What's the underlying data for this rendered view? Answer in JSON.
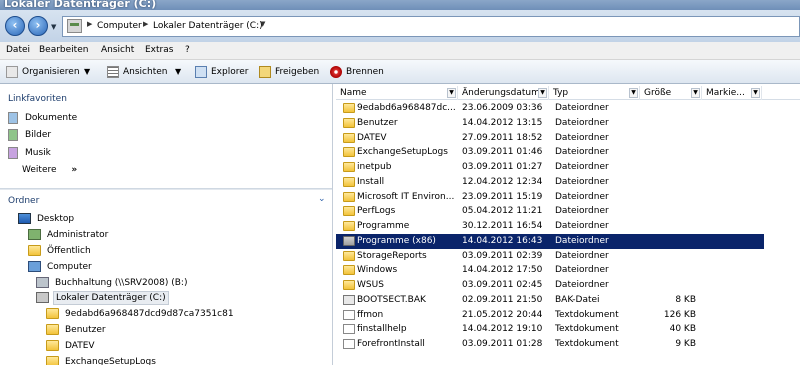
{
  "window": {
    "title": "Lokaler Datenträger (C:)"
  },
  "address": {
    "crumbs": [
      "Computer",
      "Lokaler Datenträger (C:)"
    ]
  },
  "menu": [
    "Datei",
    "Bearbeiten",
    "Ansicht",
    "Extras",
    "?"
  ],
  "toolbar": {
    "organize": "Organisieren",
    "views": "Ansichten",
    "explorer": "Explorer",
    "share": "Freigeben",
    "burn": "Brennen"
  },
  "left": {
    "favorites_title": "Linkfavoriten",
    "favorites": [
      "Dokumente",
      "Bilder",
      "Musik",
      "Weitere"
    ],
    "more_chevron": "»",
    "folders_title": "Ordner",
    "tree": [
      {
        "label": "Desktop",
        "icon": "desktop-icon"
      },
      {
        "label": "Administrator",
        "icon": "user-icon"
      },
      {
        "label": "Öffentlich",
        "icon": "folder-icon"
      },
      {
        "label": "Computer",
        "icon": "computer-icon"
      },
      {
        "label": "Buchhaltung (\\\\SRV2008) (B:)",
        "icon": "network-drive-icon"
      },
      {
        "label": "Lokaler Datenträger (C:)",
        "icon": "hard-drive-icon"
      },
      {
        "label": "9edabd6a968487dcd9d87ca7351c81",
        "icon": "folder-icon"
      },
      {
        "label": "Benutzer",
        "icon": "folder-icon"
      },
      {
        "label": "DATEV",
        "icon": "folder-icon"
      },
      {
        "label": "ExchangeSetupLogs",
        "icon": "folder-icon"
      }
    ]
  },
  "columns": [
    "Name",
    "Änderungsdatum",
    "Typ",
    "Größe",
    "Markie..."
  ],
  "files": [
    {
      "name": "9edabd6a968487dc...",
      "date": "23.06.2009 03:36",
      "type": "Dateiordner",
      "size": "",
      "icon": "folder-icon"
    },
    {
      "name": "Benutzer",
      "date": "14.04.2012 13:15",
      "type": "Dateiordner",
      "size": "",
      "icon": "folder-icon"
    },
    {
      "name": "DATEV",
      "date": "27.09.2011 18:52",
      "type": "Dateiordner",
      "size": "",
      "icon": "folder-icon"
    },
    {
      "name": "ExchangeSetupLogs",
      "date": "03.09.2011 01:46",
      "type": "Dateiordner",
      "size": "",
      "icon": "folder-icon"
    },
    {
      "name": "inetpub",
      "date": "03.09.2011 01:27",
      "type": "Dateiordner",
      "size": "",
      "icon": "folder-icon"
    },
    {
      "name": "Install",
      "date": "12.04.2012 12:34",
      "type": "Dateiordner",
      "size": "",
      "icon": "folder-icon"
    },
    {
      "name": "Microsoft IT Environ...",
      "date": "23.09.2011 15:19",
      "type": "Dateiordner",
      "size": "",
      "icon": "folder-icon"
    },
    {
      "name": "PerfLogs",
      "date": "05.04.2012 11:21",
      "type": "Dateiordner",
      "size": "",
      "icon": "folder-icon"
    },
    {
      "name": "Programme",
      "date": "30.12.2011 16:54",
      "type": "Dateiordner",
      "size": "",
      "icon": "folder-icon"
    },
    {
      "name": "Programme (x86)",
      "date": "14.04.2012 16:43",
      "type": "Dateiordner",
      "size": "",
      "icon": "folder-icon",
      "selected": true
    },
    {
      "name": "StorageReports",
      "date": "03.09.2011 02:39",
      "type": "Dateiordner",
      "size": "",
      "icon": "folder-icon"
    },
    {
      "name": "Windows",
      "date": "14.04.2012 17:50",
      "type": "Dateiordner",
      "size": "",
      "icon": "folder-icon"
    },
    {
      "name": "WSUS",
      "date": "03.09.2011 02:45",
      "type": "Dateiordner",
      "size": "",
      "icon": "folder-icon"
    },
    {
      "name": "BOOTSECT.BAK",
      "date": "02.09.2011 21:50",
      "type": "BAK-Datei",
      "size": "8 KB",
      "icon": "file-icon"
    },
    {
      "name": "ffmon",
      "date": "21.05.2012 20:44",
      "type": "Textdokument",
      "size": "126 KB",
      "icon": "text-file-icon"
    },
    {
      "name": "finstallhelp",
      "date": "14.04.2012 19:10",
      "type": "Textdokument",
      "size": "40 KB",
      "icon": "text-file-icon"
    },
    {
      "name": "ForefrontInstall",
      "date": "03.09.2011 01:28",
      "type": "Textdokument",
      "size": "9 KB",
      "icon": "text-file-icon"
    }
  ],
  "colors": {
    "selection": "#0a246a",
    "link": "#1c3c6c"
  }
}
